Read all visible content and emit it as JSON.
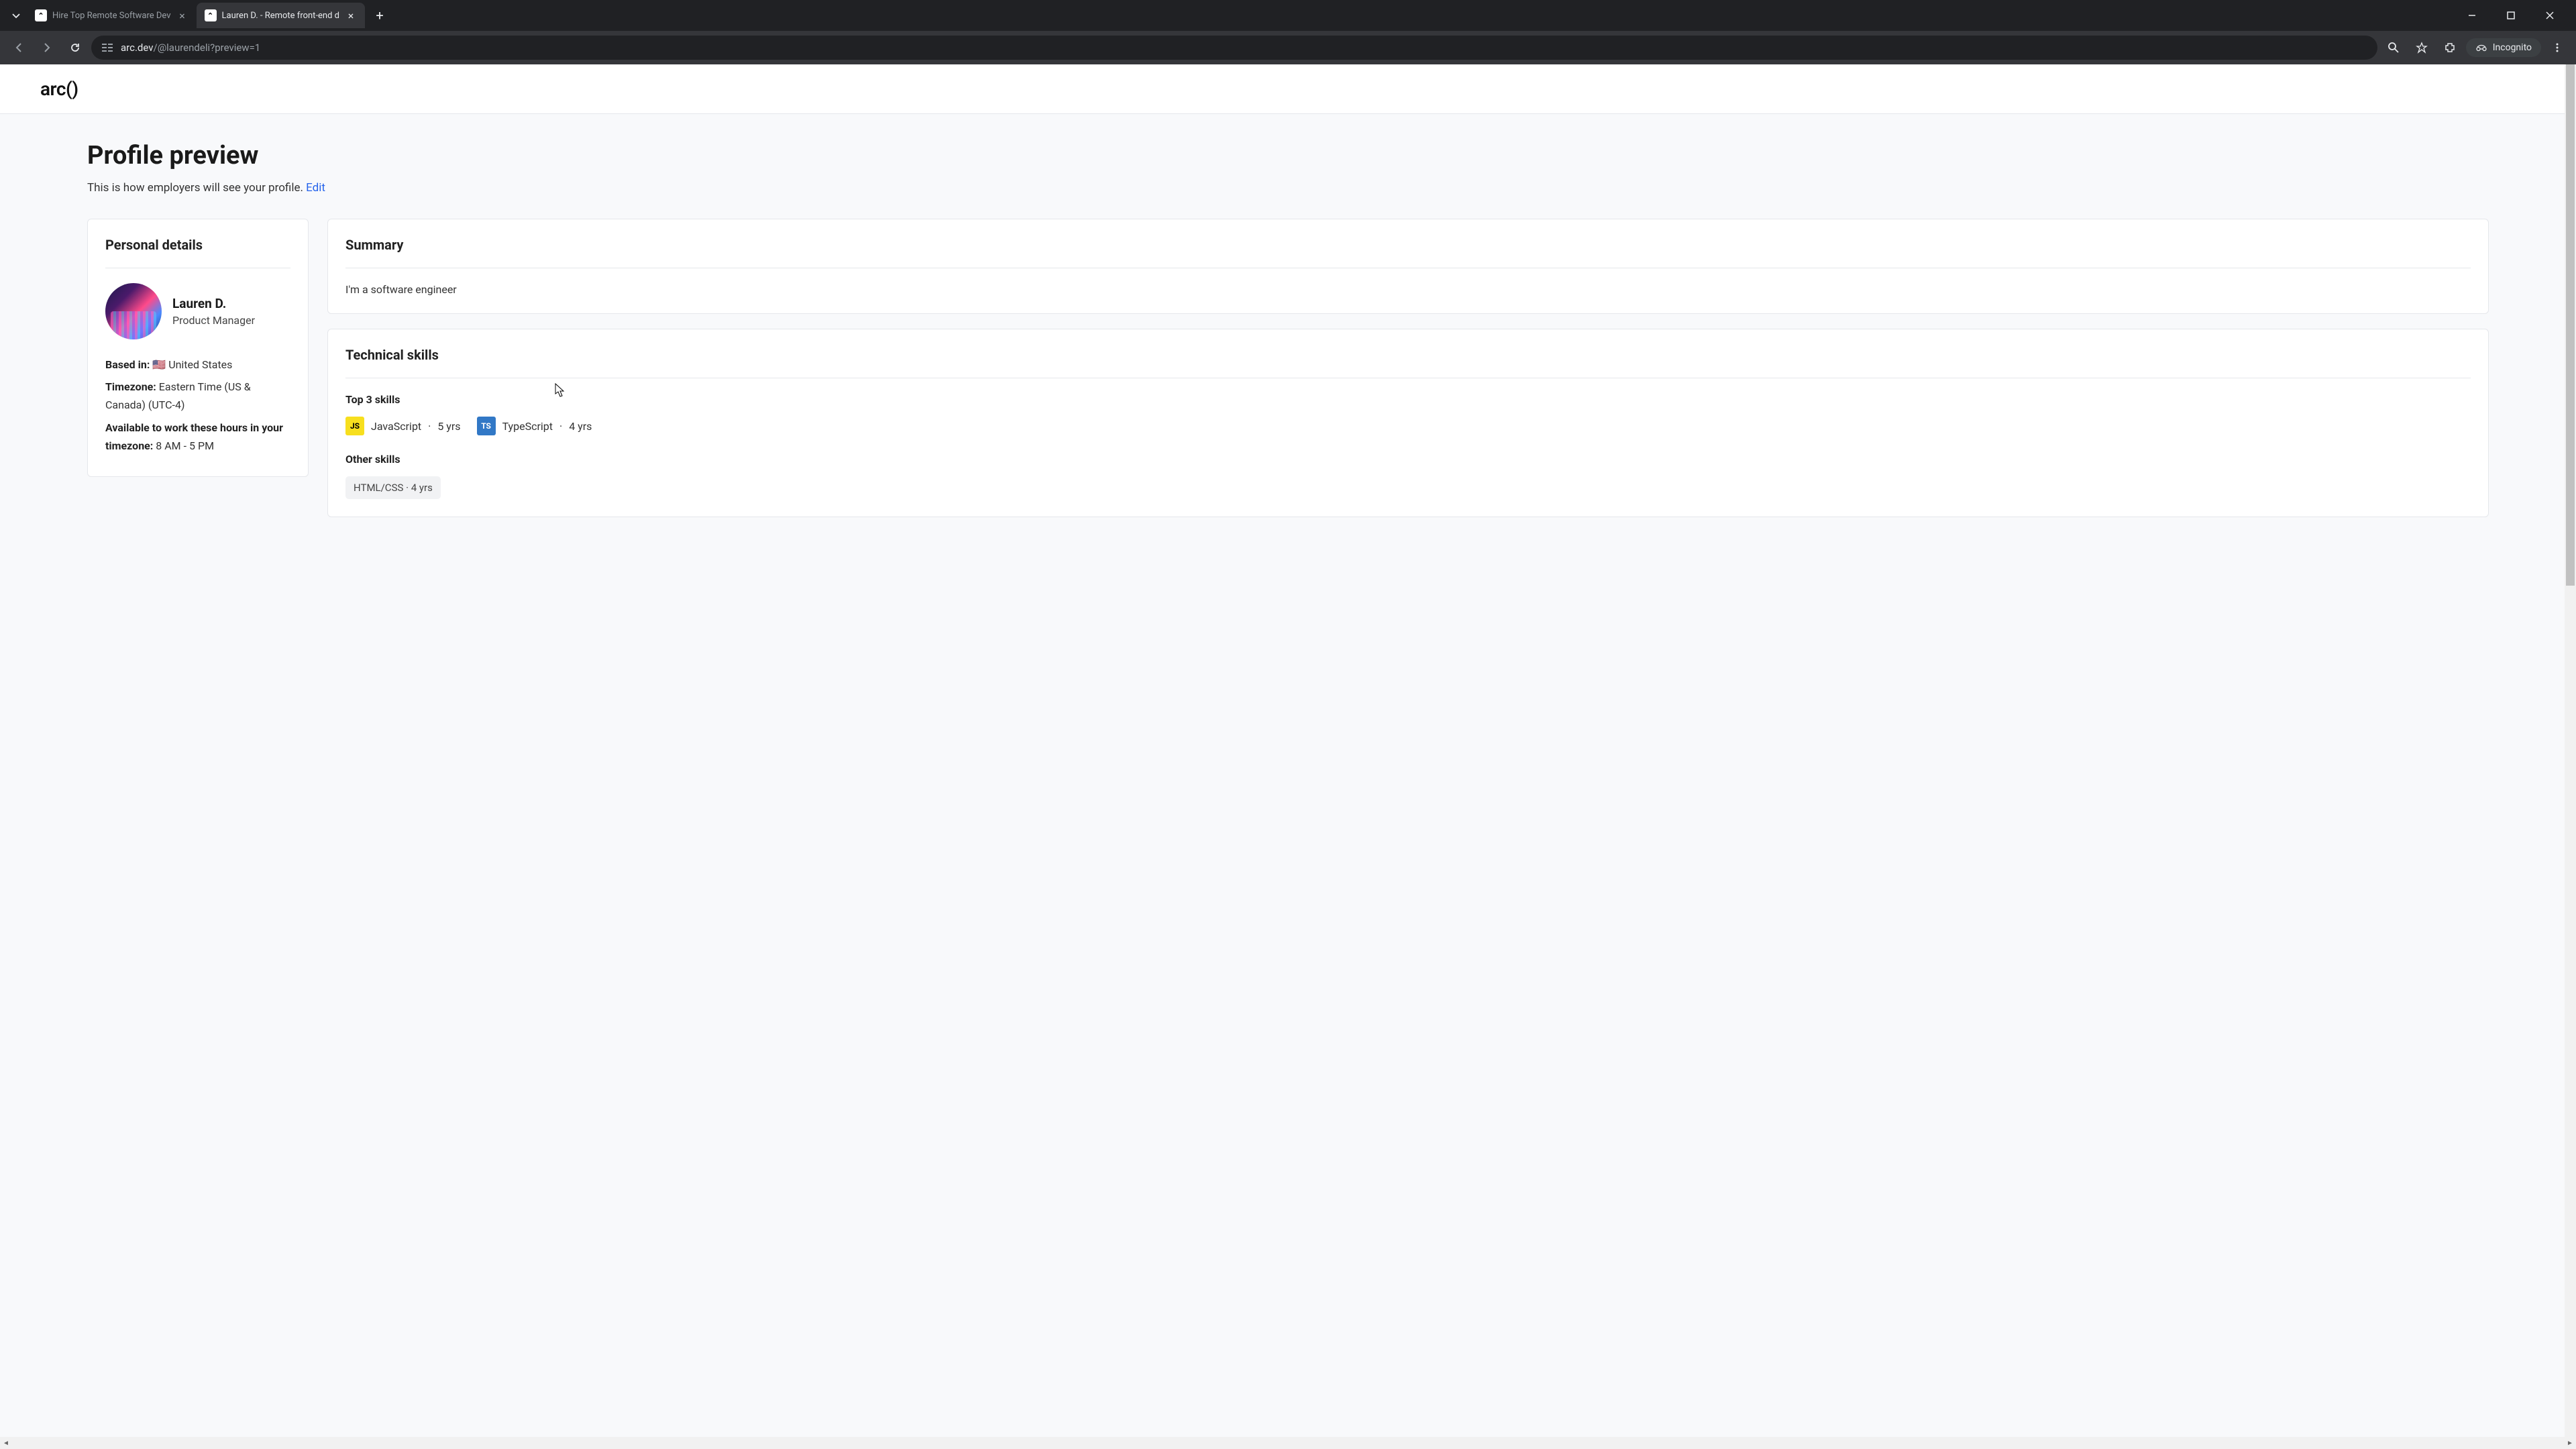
{
  "browser": {
    "tabs": [
      {
        "title": "Hire Top Remote Software Dev",
        "active": false
      },
      {
        "title": "Lauren D. - Remote front-end d",
        "active": true
      }
    ],
    "url_domain": "arc.dev",
    "url_path": "/@laurendeli?preview=1",
    "incognito_label": "Incognito"
  },
  "header": {
    "logo": "arc()"
  },
  "page": {
    "title": "Profile preview",
    "subtitle_prefix": "This is how employers will see your profile. ",
    "edit_label": "Edit"
  },
  "personal": {
    "title": "Personal details",
    "name": "Lauren D.",
    "role": "Product Manager",
    "based_in_label": "Based in:",
    "based_in_value": " 🇺🇸 United States",
    "timezone_label": "Timezone:",
    "timezone_value": " Eastern Time (US & Canada) (UTC-4)",
    "hours_label": "Available to work these hours in your timezone:",
    "hours_value": " 8 AM - 5 PM"
  },
  "summary": {
    "title": "Summary",
    "text": "I'm a software engineer"
  },
  "skills": {
    "title": "Technical skills",
    "top_label": "Top 3 skills",
    "top": [
      {
        "icon": "JS",
        "icon_class": "js",
        "name": "JavaScript",
        "years": "5 yrs"
      },
      {
        "icon": "TS",
        "icon_class": "ts",
        "name": "TypeScript",
        "years": "4 yrs"
      }
    ],
    "other_label": "Other skills",
    "other": [
      {
        "name": "HTML/CSS",
        "years": "4 yrs"
      }
    ]
  }
}
